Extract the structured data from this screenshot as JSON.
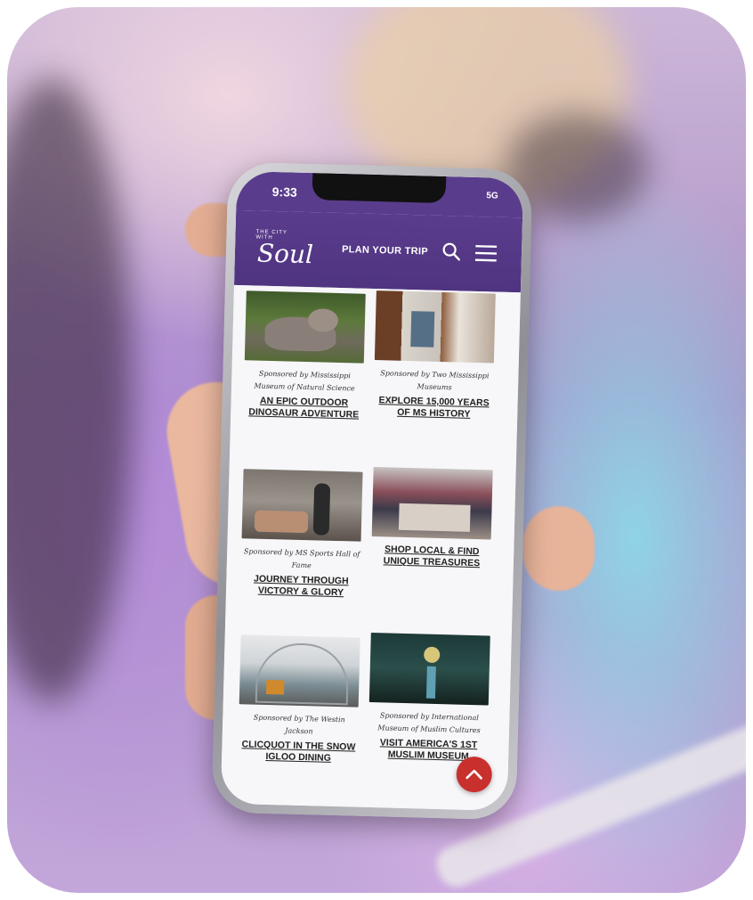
{
  "status": {
    "time": "9:33",
    "network": "5G"
  },
  "header": {
    "logo_small": "THE CITY WITH",
    "logo_main": "Soul",
    "plan_label": "PLAN YOUR TRIP"
  },
  "cards": [
    {
      "sponsor": "Sponsored by Mississippi Museum of Natural Science",
      "title": "AN EPIC OUTDOOR DINOSAUR ADVENTURE"
    },
    {
      "sponsor": "Sponsored by Two Mississippi Museums",
      "title": "EXPLORE 15,000 YEARS OF MS HISTORY"
    },
    {
      "sponsor": "Sponsored by MS Sports Hall of Fame",
      "title": "JOURNEY THROUGH VICTORY & GLORY"
    },
    {
      "sponsor": "",
      "title": "SHOP LOCAL & FIND UNIQUE TREASURES"
    },
    {
      "sponsor": "Sponsored by The Westin Jackson",
      "title": "CLICQUOT IN THE SNOW IGLOO DINING"
    },
    {
      "sponsor": "Sponsored by International Museum of Muslim Cultures",
      "title": "VISIT AMERICA'S 1ST MUSLIM MUSEUM"
    }
  ],
  "icons": {
    "search": "search-icon",
    "menu": "menu-icon",
    "back_to_top": "chevron-up-icon"
  },
  "colors": {
    "brand_purple": "#5a3c8c",
    "fab_red": "#c8302e"
  }
}
